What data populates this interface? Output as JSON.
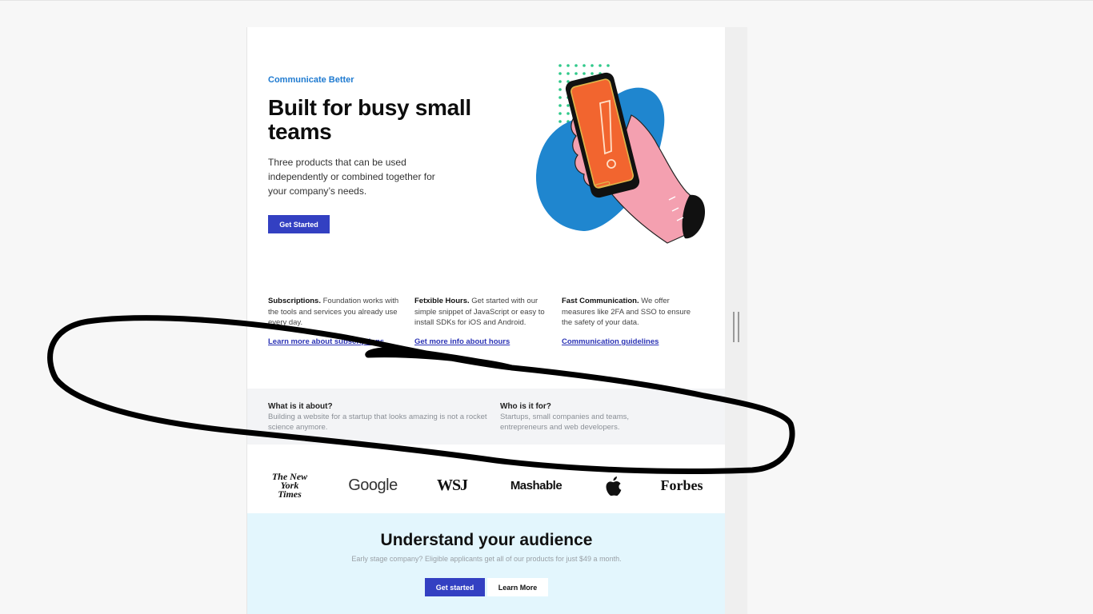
{
  "hero": {
    "eyebrow": "Communicate Better",
    "title": "Built for busy small teams",
    "description": "Three products that can be used independently or combined together for your company’s needs.",
    "cta_label": "Get Started"
  },
  "features": [
    {
      "title": "Subscriptions.",
      "text": " Foundation works with the tools and services you already use every day.",
      "link": "Learn more about subscriptions"
    },
    {
      "title": "Fetxible Hours.",
      "text": " Get started with our simple snippet of JavaScript or easy to install SDKs for iOS and Android.",
      "link": "Get more info about hours"
    },
    {
      "title": "Fast Communication.",
      "text": " We offer measures like 2FA and SSO to ensure the safety of your data.",
      "link": "Communication guidelines"
    }
  ],
  "info": {
    "about_title": "What is it about?",
    "about_text": "Building a website for a startup that looks amazing is not a rocket science anymore.",
    "for_title": "Who is it for?",
    "for_text": "Startups, small companies and teams, entrepreneurs and web developers."
  },
  "logos": {
    "nyt": "The New York Times",
    "google": "Google",
    "wsj": "WSJ",
    "mashable": "Mashable",
    "apple": "apple-logo",
    "forbes": "Forbes"
  },
  "cta": {
    "title": "Understand your audience",
    "subtitle": "Early stage company? Eligible applicants get all of our products for just $49 a month.",
    "primary_label": "Get started",
    "secondary_label": "Learn More"
  },
  "colors": {
    "accent": "#3340c2",
    "eyebrow": "#1e7ad0",
    "cta_band": "#e3f6fd",
    "info_band": "#f3f4f6"
  }
}
